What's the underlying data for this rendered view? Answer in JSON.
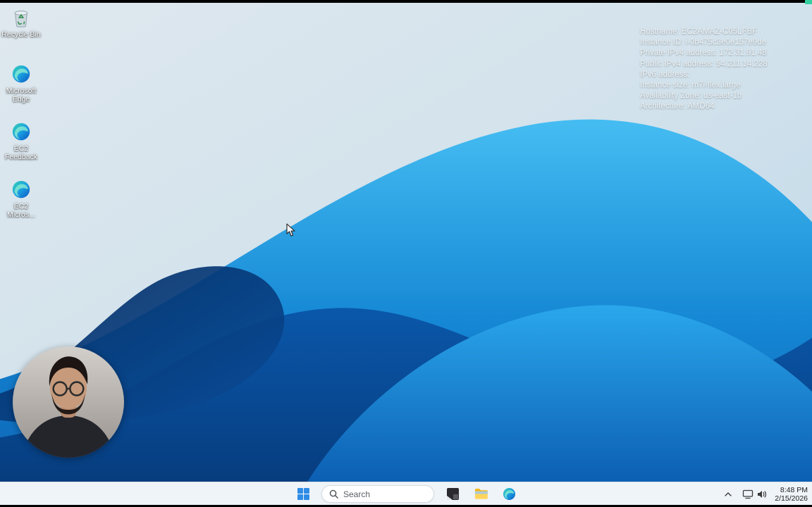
{
  "desktop": {
    "icons": [
      {
        "label": "Recycle Bin",
        "icon": "recycle-bin-icon"
      },
      {
        "label": "Microsoft Edge",
        "icon": "edge-icon"
      },
      {
        "label": "EC2 Feedback",
        "icon": "edge-icon"
      },
      {
        "label": "EC2 Micros...",
        "icon": "edge-icon"
      }
    ],
    "instance_info": {
      "lines": [
        "Hostname: EC2AMAZ-C05LFBF",
        "Instance ID: i-0b475c3e0e157e9de",
        "Private IPv4 address: 172.31.91.48",
        "Public IPv4 address: 54.211.14.228",
        "IPv6 address:",
        "Instance size: m7i-flex.large",
        "Availability Zone: us-east-1b",
        "Architecture: AMD64"
      ]
    }
  },
  "taskbar": {
    "search_placeholder": "Search",
    "tray": {
      "time": "8:48 PM",
      "date": "2/15/2026"
    }
  },
  "icons": {
    "start": "windows-logo",
    "search": "magnifier",
    "dark_app": "dark-window",
    "file_explorer": "folder",
    "edge": "edge-swirl",
    "tray_chevron": "chevron-up",
    "network": "monitor",
    "volume": "speaker",
    "recycle_bin": "trash-can",
    "cursor": "arrow-pointer",
    "webcam": "circular-webcam-feed"
  },
  "colors": {
    "taskbar_bg": "#eff4f9",
    "wallpaper_deep_blue": "#063a7a",
    "wallpaper_bright_blue": "#45bdf2",
    "info_text": "#eef3f5",
    "recording_dot": "#35d0a0"
  }
}
